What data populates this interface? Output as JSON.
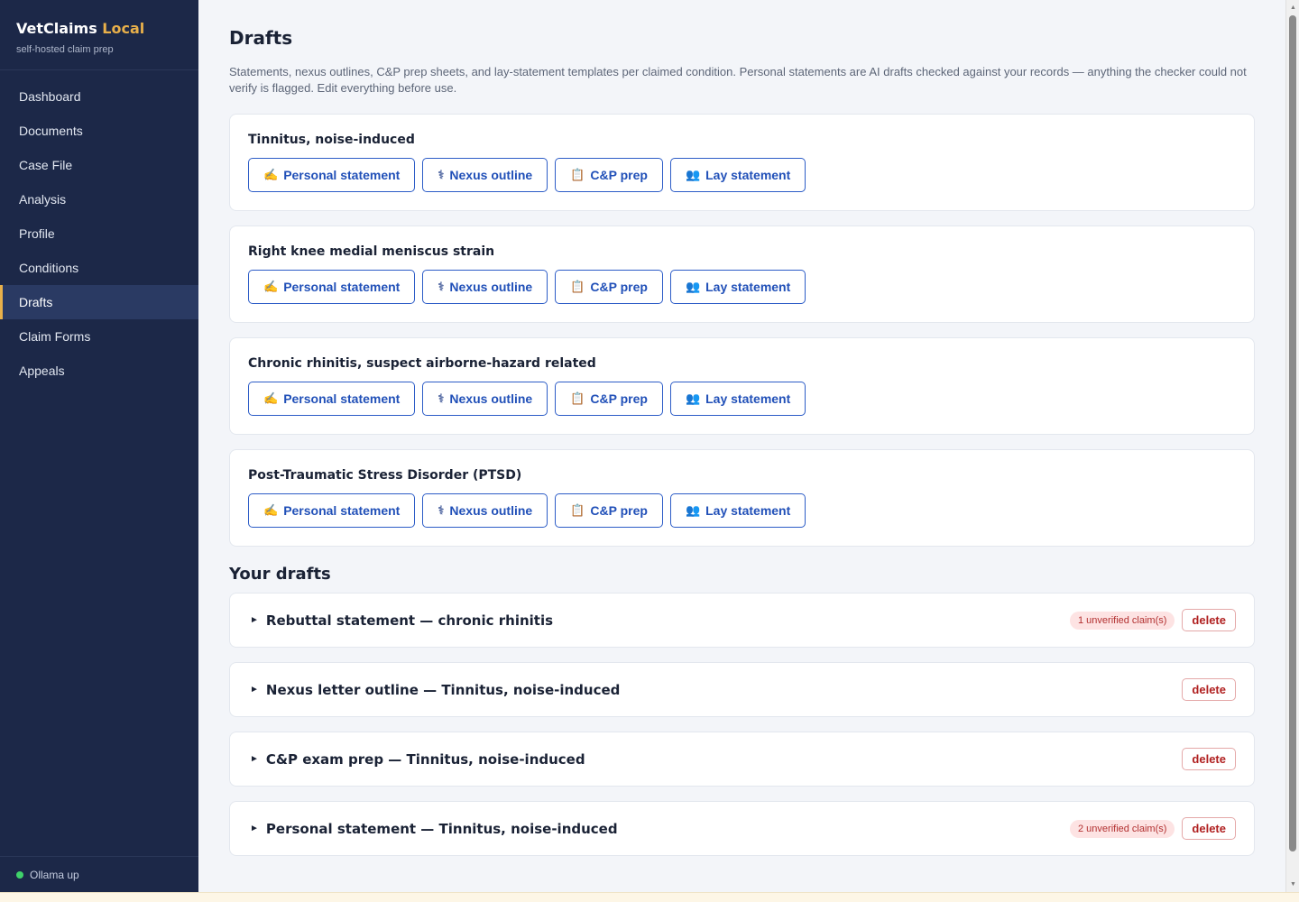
{
  "sidebar": {
    "brand_main": "VetClaims",
    "brand_accent": "Local",
    "subtitle": "self-hosted claim prep",
    "items": [
      "Dashboard",
      "Documents",
      "Case File",
      "Analysis",
      "Profile",
      "Conditions",
      "Drafts",
      "Claim Forms",
      "Appeals"
    ],
    "active": "Drafts",
    "status": "Ollama up"
  },
  "page": {
    "title": "Drafts",
    "description": "Statements, nexus outlines, C&P prep sheets, and lay-statement templates per claimed condition. Personal statements are AI drafts checked against your records — anything the checker could not verify is flagged. Edit everything before use."
  },
  "buttons": {
    "personal": "Personal statement",
    "nexus": "Nexus outline",
    "cp": "C&P prep",
    "lay": "Lay statement"
  },
  "conditions": [
    "Tinnitus, noise-induced",
    "Right knee medial meniscus strain",
    "Chronic rhinitis, suspect airborne-hazard related",
    "Post-Traumatic Stress Disorder (PTSD)"
  ],
  "drafts_section": "Your drafts",
  "drafts": [
    {
      "title": "Rebuttal statement — chronic rhinitis",
      "badge": "1 unverified claim(s)"
    },
    {
      "title": "Nexus letter outline — Tinnitus, noise-induced",
      "badge": ""
    },
    {
      "title": "C&P exam prep — Tinnitus, noise-induced",
      "badge": ""
    },
    {
      "title": "Personal statement — Tinnitus, noise-induced",
      "badge": "2 unverified claim(s)"
    }
  ],
  "delete_label": "delete",
  "icons": {
    "caret": "►",
    "pen": "✍",
    "steth": "⚕",
    "clip": "📋",
    "people": "👥"
  },
  "colors": {
    "sidebar_bg": "#1c2848",
    "accent": "#e8b04a",
    "button_blue": "#2150b8",
    "delete_red": "#b02020"
  }
}
